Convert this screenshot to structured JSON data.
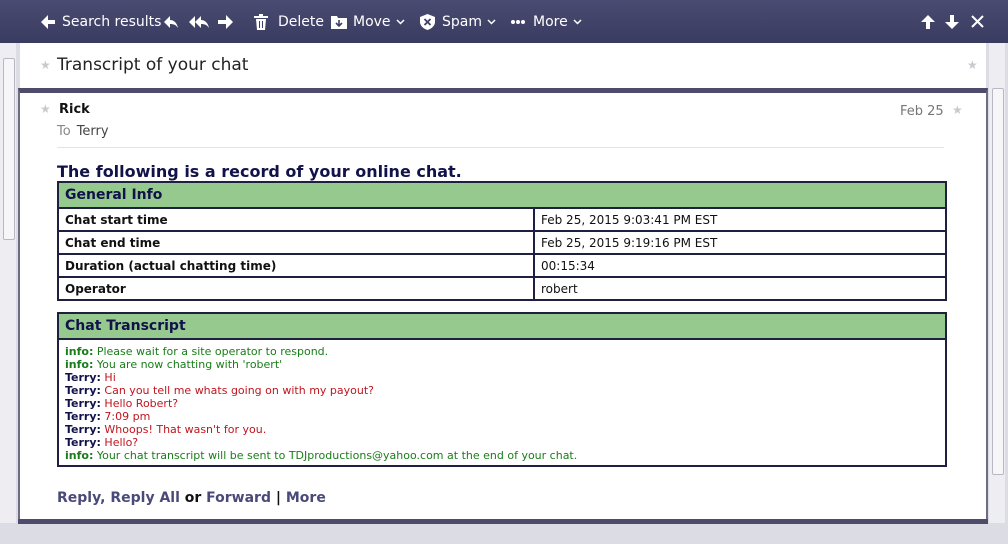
{
  "toolbar": {
    "search_results": "Search results",
    "delete": "Delete",
    "move": "Move",
    "spam": "Spam",
    "more": "More"
  },
  "email": {
    "subject": "Transcript of your chat",
    "from": "Rick",
    "to_label": "To",
    "to": "Terry",
    "date": "Feb 25",
    "heading": "The following is a record of your online chat."
  },
  "general_info": {
    "title": "General Info",
    "rows": [
      {
        "label": "Chat start time",
        "value": "Feb 25, 2015 9:03:41 PM EST"
      },
      {
        "label": "Chat end time",
        "value": "Feb 25, 2015 9:19:16 PM EST"
      },
      {
        "label": "Duration (actual chatting time)",
        "value": "00:15:34"
      },
      {
        "label": "Operator",
        "value": "robert"
      }
    ]
  },
  "transcript": {
    "title": "Chat Transcript",
    "lines": [
      {
        "speaker": "info:",
        "text": "Please wait for a site operator to respond."
      },
      {
        "speaker": "info:",
        "text": "You are now chatting with 'robert'"
      },
      {
        "speaker": "Terry:",
        "text": "Hi"
      },
      {
        "speaker": "Terry:",
        "text": "Can you tell me whats going on with my payout?"
      },
      {
        "speaker": "Terry:",
        "text": "Hello Robert?"
      },
      {
        "speaker": "Terry:",
        "text": "7:09 pm"
      },
      {
        "speaker": "Terry:",
        "text": "Whoops! That wasn't for you."
      },
      {
        "speaker": "Terry:",
        "text": "Hello?"
      },
      {
        "speaker": "info:",
        "text": "Your chat transcript will be sent to TDJproductions@yahoo.com at the end of your chat."
      }
    ]
  },
  "actions": {
    "reply": "Reply",
    "comma": ",",
    "reply_all": "Reply All",
    "or": "or",
    "forward": "Forward",
    "pipe": "|",
    "more": "More"
  },
  "icons": {
    "back": "arrow-left-icon",
    "reply": "reply-icon",
    "reply_all": "reply-all-icon",
    "forward": "forward-icon",
    "delete": "trash-icon",
    "move": "folder-move-icon",
    "spam": "shield-icon",
    "more": "ellipsis-icon",
    "prev": "arrow-up-icon",
    "next": "arrow-down-icon",
    "close": "close-icon"
  },
  "colors": {
    "toolbar": "#3f4066",
    "table_header": "#95c98e",
    "info_text": "#1a7d1a",
    "user_text": "#c0151e",
    "heading": "#12124a"
  }
}
